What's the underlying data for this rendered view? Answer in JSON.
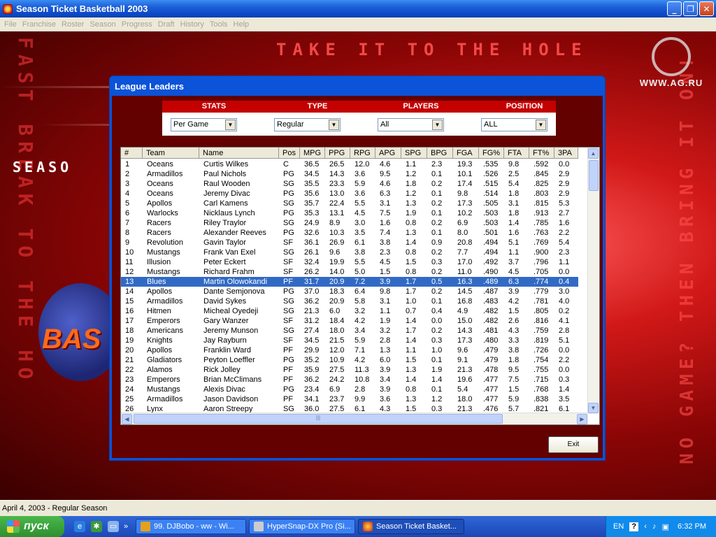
{
  "window": {
    "title": "Season Ticket Basketball 2003"
  },
  "menu": [
    "File",
    "Franchise",
    "Roster",
    "Season",
    "Progress",
    "Draft",
    "History",
    "Tools",
    "Help"
  ],
  "background": {
    "banner": "TAKE IT TO THE HOLE",
    "side_text": "FAST BREAK TO THE HO",
    "right_text": "NO GAME? THEN BRING IT ON!",
    "season_text": "SEASO",
    "logo_text": "BAS"
  },
  "watermark": {
    "text": "WWW.AG.RU"
  },
  "dialog": {
    "title": "League Leaders",
    "filters": [
      {
        "label": "STATS",
        "value": "Per Game"
      },
      {
        "label": "TYPE",
        "value": "Regular"
      },
      {
        "label": "PLAYERS",
        "value": "All"
      },
      {
        "label": "POSITION",
        "value": "ALL"
      }
    ],
    "columns": [
      "#",
      "Team",
      "Name",
      "Pos",
      "MPG",
      "PPG",
      "RPG",
      "APG",
      "SPG",
      "BPG",
      "FGA",
      "FG%",
      "FTA",
      "FT%",
      "3PA"
    ],
    "rows": [
      [
        "1",
        "Oceans",
        "Curtis Wilkes",
        "C",
        "36.5",
        "26.5",
        "12.0",
        "4.6",
        "1.1",
        "2.3",
        "19.3",
        ".535",
        "9.8",
        ".592",
        "0.0"
      ],
      [
        "2",
        "Armadillos",
        "Paul Nichols",
        "PG",
        "34.5",
        "14.3",
        "3.6",
        "9.5",
        "1.2",
        "0.1",
        "10.1",
        ".526",
        "2.5",
        ".845",
        "2.9"
      ],
      [
        "3",
        "Oceans",
        "Raul Wooden",
        "SG",
        "35.5",
        "23.3",
        "5.9",
        "4.6",
        "1.8",
        "0.2",
        "17.4",
        ".515",
        "5.4",
        ".825",
        "2.9"
      ],
      [
        "4",
        "Oceans",
        "Jeremy Divac",
        "PG",
        "35.6",
        "13.0",
        "3.6",
        "6.3",
        "1.2",
        "0.1",
        "9.8",
        ".514",
        "1.8",
        ".803",
        "2.9"
      ],
      [
        "5",
        "Apollos",
        "Carl Kamens",
        "SG",
        "35.7",
        "22.4",
        "5.5",
        "3.1",
        "1.3",
        "0.2",
        "17.3",
        ".505",
        "3.1",
        ".815",
        "5.3"
      ],
      [
        "6",
        "Warlocks",
        "Nicklaus Lynch",
        "PG",
        "35.3",
        "13.1",
        "4.5",
        "7.5",
        "1.9",
        "0.1",
        "10.2",
        ".503",
        "1.8",
        ".913",
        "2.7"
      ],
      [
        "7",
        "Racers",
        "Riley Traylor",
        "SG",
        "24.9",
        "8.9",
        "3.0",
        "1.6",
        "0.8",
        "0.2",
        "6.9",
        ".503",
        "1.4",
        ".785",
        "1.6"
      ],
      [
        "8",
        "Racers",
        "Alexander Reeves",
        "PG",
        "32.6",
        "10.3",
        "3.5",
        "7.4",
        "1.3",
        "0.1",
        "8.0",
        ".501",
        "1.6",
        ".763",
        "2.2"
      ],
      [
        "9",
        "Revolution",
        "Gavin Taylor",
        "SF",
        "36.1",
        "26.9",
        "6.1",
        "3.8",
        "1.4",
        "0.9",
        "20.8",
        ".494",
        "5.1",
        ".769",
        "5.4"
      ],
      [
        "10",
        "Mustangs",
        "Frank Van Exel",
        "SG",
        "26.1",
        "9.6",
        "3.8",
        "2.3",
        "0.8",
        "0.2",
        "7.7",
        ".494",
        "1.1",
        ".900",
        "2.3"
      ],
      [
        "11",
        "Illusion",
        "Peter Eckert",
        "SF",
        "32.4",
        "19.9",
        "5.5",
        "4.5",
        "1.5",
        "0.3",
        "17.0",
        ".492",
        "3.7",
        ".796",
        "1.1"
      ],
      [
        "12",
        "Mustangs",
        "Richard Frahm",
        "SF",
        "26.2",
        "14.0",
        "5.0",
        "1.5",
        "0.8",
        "0.2",
        "11.0",
        ".490",
        "4.5",
        ".705",
        "0.0"
      ],
      [
        "13",
        "Blues",
        "Martin Olowokandi",
        "PF",
        "31.7",
        "20.9",
        "7.2",
        "3.9",
        "1.7",
        "0.5",
        "16.3",
        ".489",
        "6.3",
        ".774",
        "0.4"
      ],
      [
        "14",
        "Apollos",
        "Dante Semjonova",
        "PG",
        "37.0",
        "18.3",
        "6.4",
        "9.8",
        "1.7",
        "0.2",
        "14.5",
        ".487",
        "3.9",
        ".779",
        "3.0"
      ],
      [
        "15",
        "Armadillos",
        "David Sykes",
        "SG",
        "36.2",
        "20.9",
        "5.8",
        "3.1",
        "1.0",
        "0.1",
        "16.8",
        ".483",
        "4.2",
        ".781",
        "4.0"
      ],
      [
        "16",
        "Hitmen",
        "Micheal Oyedeji",
        "SG",
        "21.3",
        "6.0",
        "3.2",
        "1.1",
        "0.7",
        "0.4",
        "4.9",
        ".482",
        "1.5",
        ".805",
        "0.2"
      ],
      [
        "17",
        "Emperors",
        "Gary Wanzer",
        "SF",
        "31.2",
        "18.4",
        "4.2",
        "1.9",
        "1.4",
        "0.0",
        "15.0",
        ".482",
        "2.6",
        ".816",
        "4.1"
      ],
      [
        "18",
        "Americans",
        "Jeremy Munson",
        "SG",
        "27.4",
        "18.0",
        "3.4",
        "3.2",
        "1.7",
        "0.2",
        "14.3",
        ".481",
        "4.3",
        ".759",
        "2.8"
      ],
      [
        "19",
        "Knights",
        "Jay Rayburn",
        "SF",
        "34.5",
        "21.5",
        "5.9",
        "2.8",
        "1.4",
        "0.3",
        "17.3",
        ".480",
        "3.3",
        ".819",
        "5.1"
      ],
      [
        "20",
        "Apollos",
        "Franklin Ward",
        "PF",
        "29.9",
        "12.0",
        "7.1",
        "1.3",
        "1.1",
        "1.0",
        "9.6",
        ".479",
        "3.8",
        ".726",
        "0.0"
      ],
      [
        "21",
        "Gladiators",
        "Peyton Loeffler",
        "PG",
        "35.2",
        "10.9",
        "4.2",
        "6.0",
        "1.5",
        "0.1",
        "9.1",
        ".479",
        "1.8",
        ".754",
        "2.2"
      ],
      [
        "22",
        "Alamos",
        "Rick Jolley",
        "PF",
        "35.9",
        "27.5",
        "11.3",
        "3.9",
        "1.3",
        "1.9",
        "21.3",
        ".478",
        "9.5",
        ".755",
        "0.0"
      ],
      [
        "23",
        "Emperors",
        "Brian McClimans",
        "PF",
        "36.2",
        "24.2",
        "10.8",
        "3.4",
        "1.4",
        "1.4",
        "19.6",
        ".477",
        "7.5",
        ".715",
        "0.3"
      ],
      [
        "24",
        "Mustangs",
        "Alexis Divac",
        "PG",
        "23.4",
        "6.9",
        "2.8",
        "3.9",
        "0.8",
        "0.1",
        "5.4",
        ".477",
        "1.5",
        ".768",
        "1.4"
      ],
      [
        "25",
        "Armadillos",
        "Jason Davidson",
        "PF",
        "34.1",
        "23.7",
        "9.9",
        "3.6",
        "1.3",
        "1.2",
        "18.0",
        ".477",
        "5.9",
        ".838",
        "3.5"
      ],
      [
        "26",
        "Lynx",
        "Aaron Streepy",
        "SG",
        "36.0",
        "27.5",
        "6.1",
        "4.3",
        "1.5",
        "0.3",
        "21.3",
        ".476",
        "5.7",
        ".821",
        "6.1"
      ]
    ],
    "selected_row": 13,
    "exit_label": "Exit"
  },
  "status": {
    "text": "April 4, 2003 - Regular Season"
  },
  "taskbar": {
    "start_label": "пуск",
    "tasks": [
      "99. DJBobo - ww - Wi...",
      "HyperSnap-DX Pro (Si...",
      "Season Ticket Basket..."
    ],
    "lang": "EN",
    "clock": "6:32 PM"
  }
}
